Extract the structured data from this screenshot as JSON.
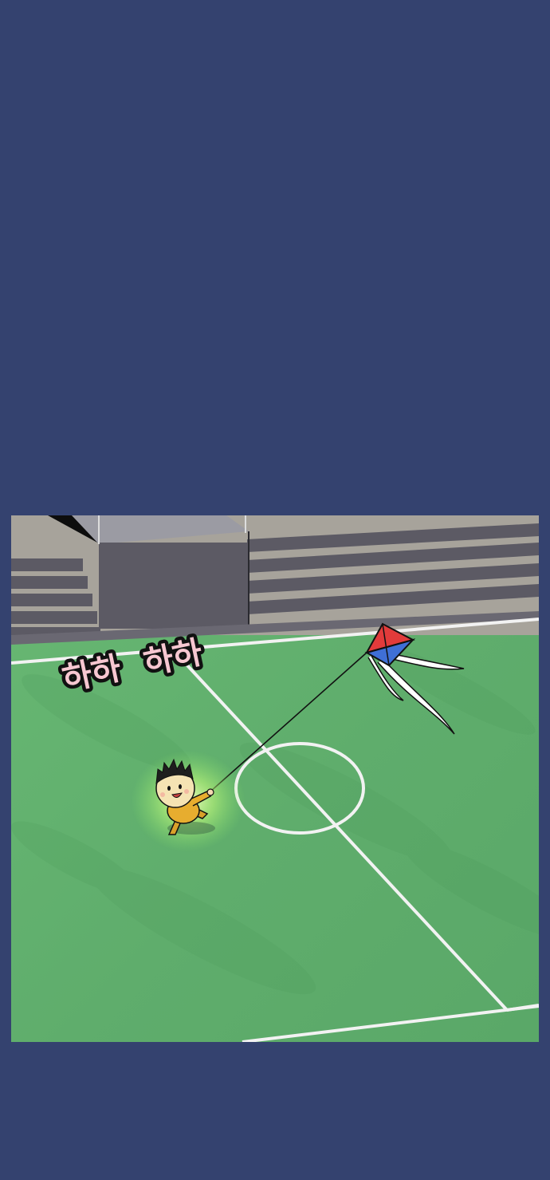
{
  "page": {
    "background_color": "#34426f"
  },
  "panel": {
    "scene": "kite-flying-on-soccer-field",
    "colors": {
      "grass": "#62b16f",
      "field_lines": "#f2f2f2",
      "bleacher_light": "#a7a39b",
      "bleacher_dark": "#5c5a64",
      "kite_red": "#e23b3b",
      "kite_blue": "#3f6fd6",
      "glow": "#d8ff86"
    },
    "sound_effect": {
      "text_1": "하하",
      "text_2": "하하"
    }
  }
}
